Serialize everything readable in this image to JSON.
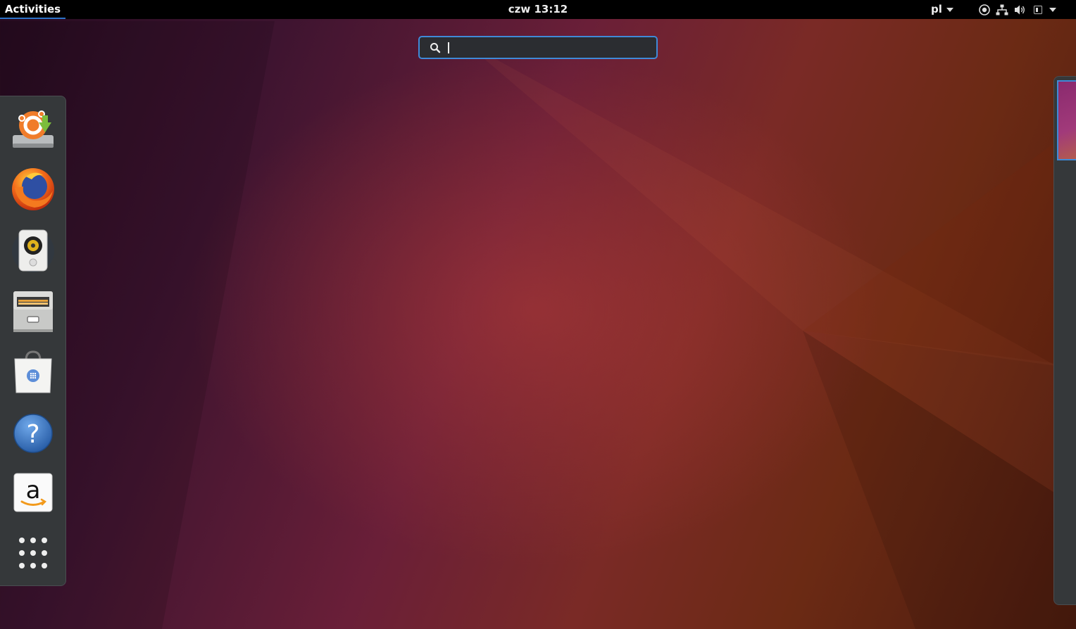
{
  "topbar": {
    "activities_label": "Activities",
    "clock": "czw 13:12",
    "language": "pl"
  },
  "tray": {
    "icons": [
      "accessibility-icon",
      "network-icon",
      "volume-icon",
      "battery-icon",
      "system-menu-arrow-icon"
    ]
  },
  "search": {
    "value": "",
    "placeholder": ""
  },
  "dash": {
    "items": [
      {
        "name": "software-updater",
        "icon": "software-updater-icon"
      },
      {
        "name": "firefox",
        "icon": "firefox-icon"
      },
      {
        "name": "rhythmbox",
        "icon": "rhythmbox-icon"
      },
      {
        "name": "files",
        "icon": "files-icon"
      },
      {
        "name": "ubuntu-software",
        "icon": "ubuntu-software-icon"
      },
      {
        "name": "help",
        "icon": "help-icon"
      },
      {
        "name": "amazon",
        "icon": "amazon-icon"
      },
      {
        "name": "show-applications",
        "icon": "app-grid-icon"
      }
    ]
  },
  "colors": {
    "accent": "#3f8ad8",
    "topbar": "#000000",
    "dash_bg": "#35383a"
  }
}
